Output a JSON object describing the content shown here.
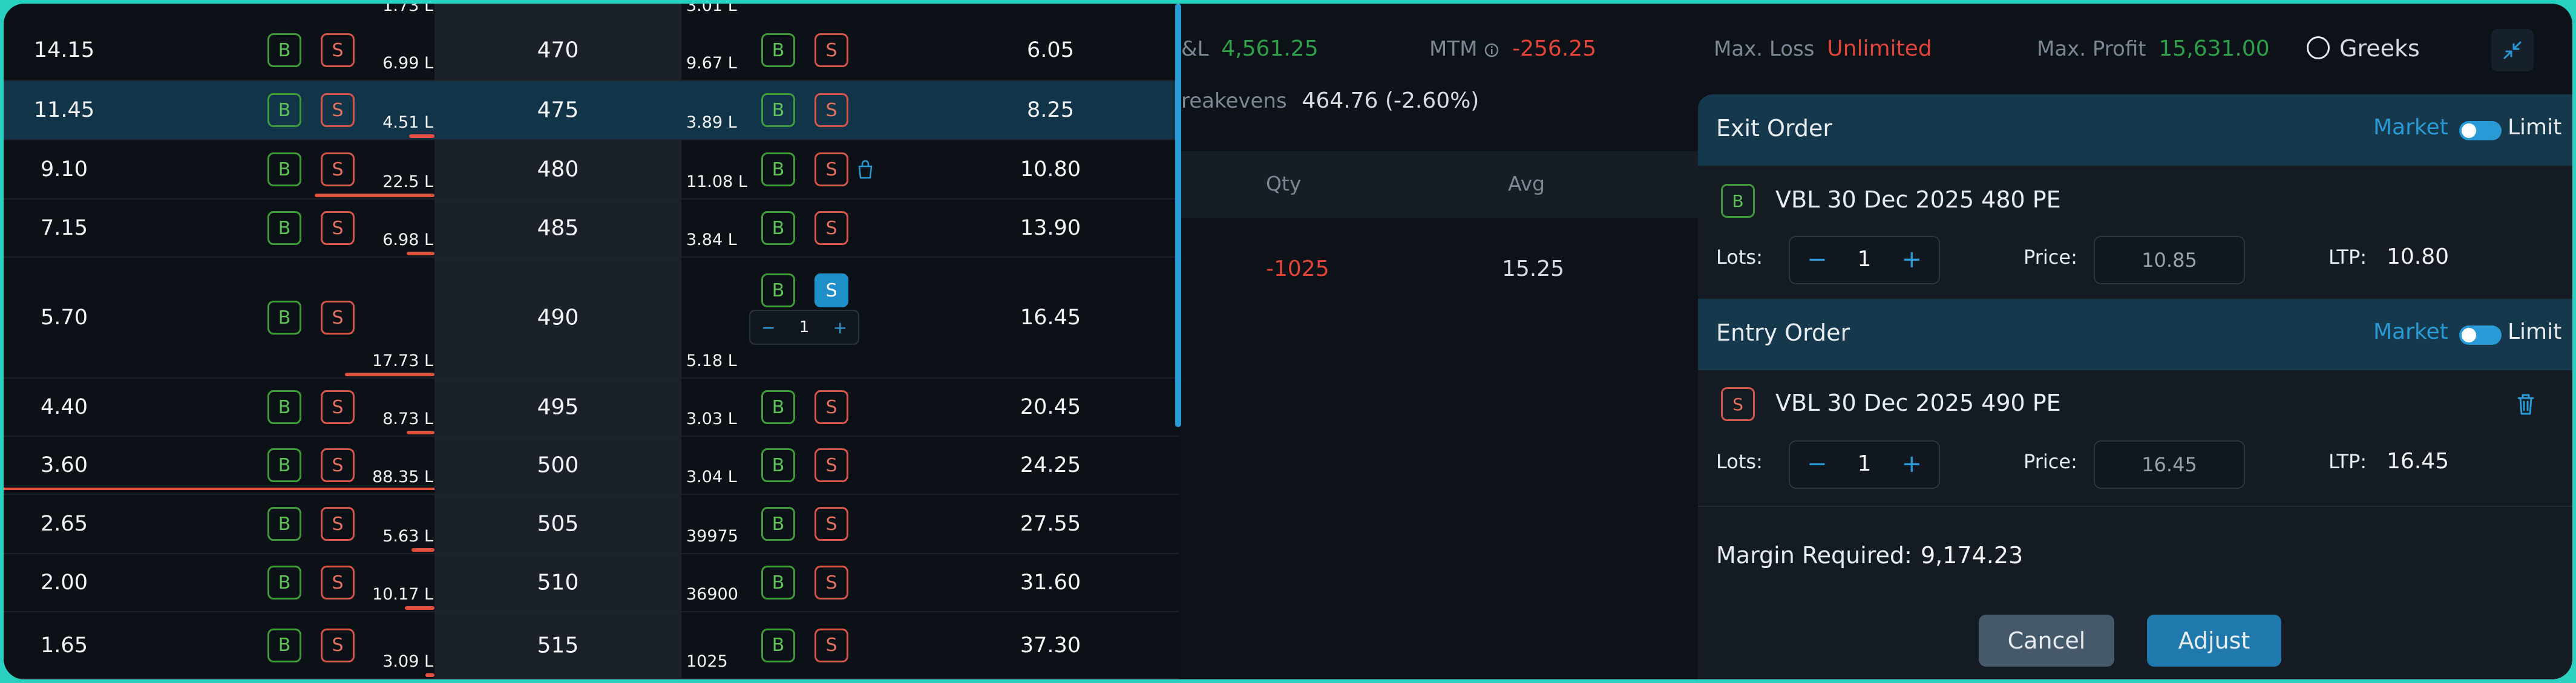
{
  "chain": {
    "rows": [
      {
        "call_ltp": "14.15",
        "call_oi": "6.99 L",
        "strike": "470",
        "put_oi": "9.67 L",
        "put_ltp": "6.05",
        "call_bar": 0
      },
      {
        "call_ltp": "11.45",
        "call_oi": "4.51 L",
        "strike": "475",
        "put_oi": "3.89 L",
        "put_ltp": "8.25",
        "call_bar": 0.11
      },
      {
        "call_ltp": "9.10",
        "call_oi": "22.5 L",
        "strike": "480",
        "put_oi": "11.08 L",
        "put_ltp": "10.80",
        "call_bar": 0.52
      },
      {
        "call_ltp": "7.15",
        "call_oi": "6.98 L",
        "strike": "485",
        "put_oi": "3.84 L",
        "put_ltp": "13.90",
        "call_bar": 0.12
      },
      {
        "call_ltp": "5.70",
        "call_oi": "17.73 L",
        "strike": "490",
        "put_oi": "5.18 L",
        "put_ltp": "16.45",
        "call_bar": 0.39
      },
      {
        "call_ltp": "4.40",
        "call_oi": "8.73 L",
        "strike": "495",
        "put_oi": "3.03 L",
        "put_ltp": "20.45",
        "call_bar": 0.12
      },
      {
        "call_ltp": "3.60",
        "call_oi": "88.35 L",
        "strike": "500",
        "put_oi": "3.04 L",
        "put_ltp": "24.25",
        "call_bar": 0
      },
      {
        "call_ltp": "2.65",
        "call_oi": "5.63 L",
        "strike": "505",
        "put_oi": "39975",
        "put_ltp": "27.55",
        "call_bar": 0.1
      },
      {
        "call_ltp": "2.00",
        "call_oi": "10.17 L",
        "strike": "510",
        "put_oi": "36900",
        "put_ltp": "31.60",
        "call_bar": 0.13
      },
      {
        "call_ltp": "1.65",
        "call_oi": "3.09 L",
        "strike": "515",
        "put_oi": "1025",
        "put_ltp": "37.30",
        "call_bar": 0.04
      }
    ],
    "top_call_oi": "1.73 L",
    "top_put_oi": "3.01 L",
    "buy_label": "B",
    "sell_label": "S",
    "mini_qty": "1",
    "minus": "−",
    "plus": "+"
  },
  "summary": {
    "pnl_label": "&L",
    "pnl_value": "4,561.25",
    "mtm_label": "MTM",
    "mtm_value": "-256.25",
    "max_loss_label": "Max. Loss",
    "max_loss_value": "Unlimited",
    "max_profit_label": "Max. Profit",
    "max_profit_value": "15,631.00",
    "breakevens_label": "reakevens",
    "breakevens_value": "464.76  (-2.60%)",
    "greeks_label": "Greeks"
  },
  "positions": {
    "qty_header": "Qty",
    "avg_header": "Avg",
    "qty": "-1025",
    "avg": "15.25"
  },
  "panel": {
    "exit": {
      "title": "Exit Order",
      "market_label": "Market",
      "limit_label": "Limit",
      "side": "B",
      "instrument": "VBL 30 Dec 2025 480 PE",
      "lots_label": "Lots:",
      "lots": "1",
      "price_label": "Price:",
      "price": "10.85",
      "ltp_label": "LTP:",
      "ltp": "10.80"
    },
    "entry": {
      "title": "Entry Order",
      "market_label": "Market",
      "limit_label": "Limit",
      "side": "S",
      "instrument": "VBL 30 Dec 2025 490 PE",
      "lots_label": "Lots:",
      "lots": "1",
      "price_label": "Price:",
      "price": "16.45",
      "ltp_label": "LTP:",
      "ltp": "16.45"
    },
    "margin_label": "Margin Required:",
    "margin_value": "9,174.23",
    "cancel_label": "Cancel",
    "adjust_label": "Adjust",
    "minus": "−",
    "plus": "+"
  },
  "colors": {
    "accent": "#2a9ad6",
    "buy": "#5fc35a",
    "sell": "#e2705f",
    "loss": "#e2443a",
    "profit": "#2f9f49"
  }
}
